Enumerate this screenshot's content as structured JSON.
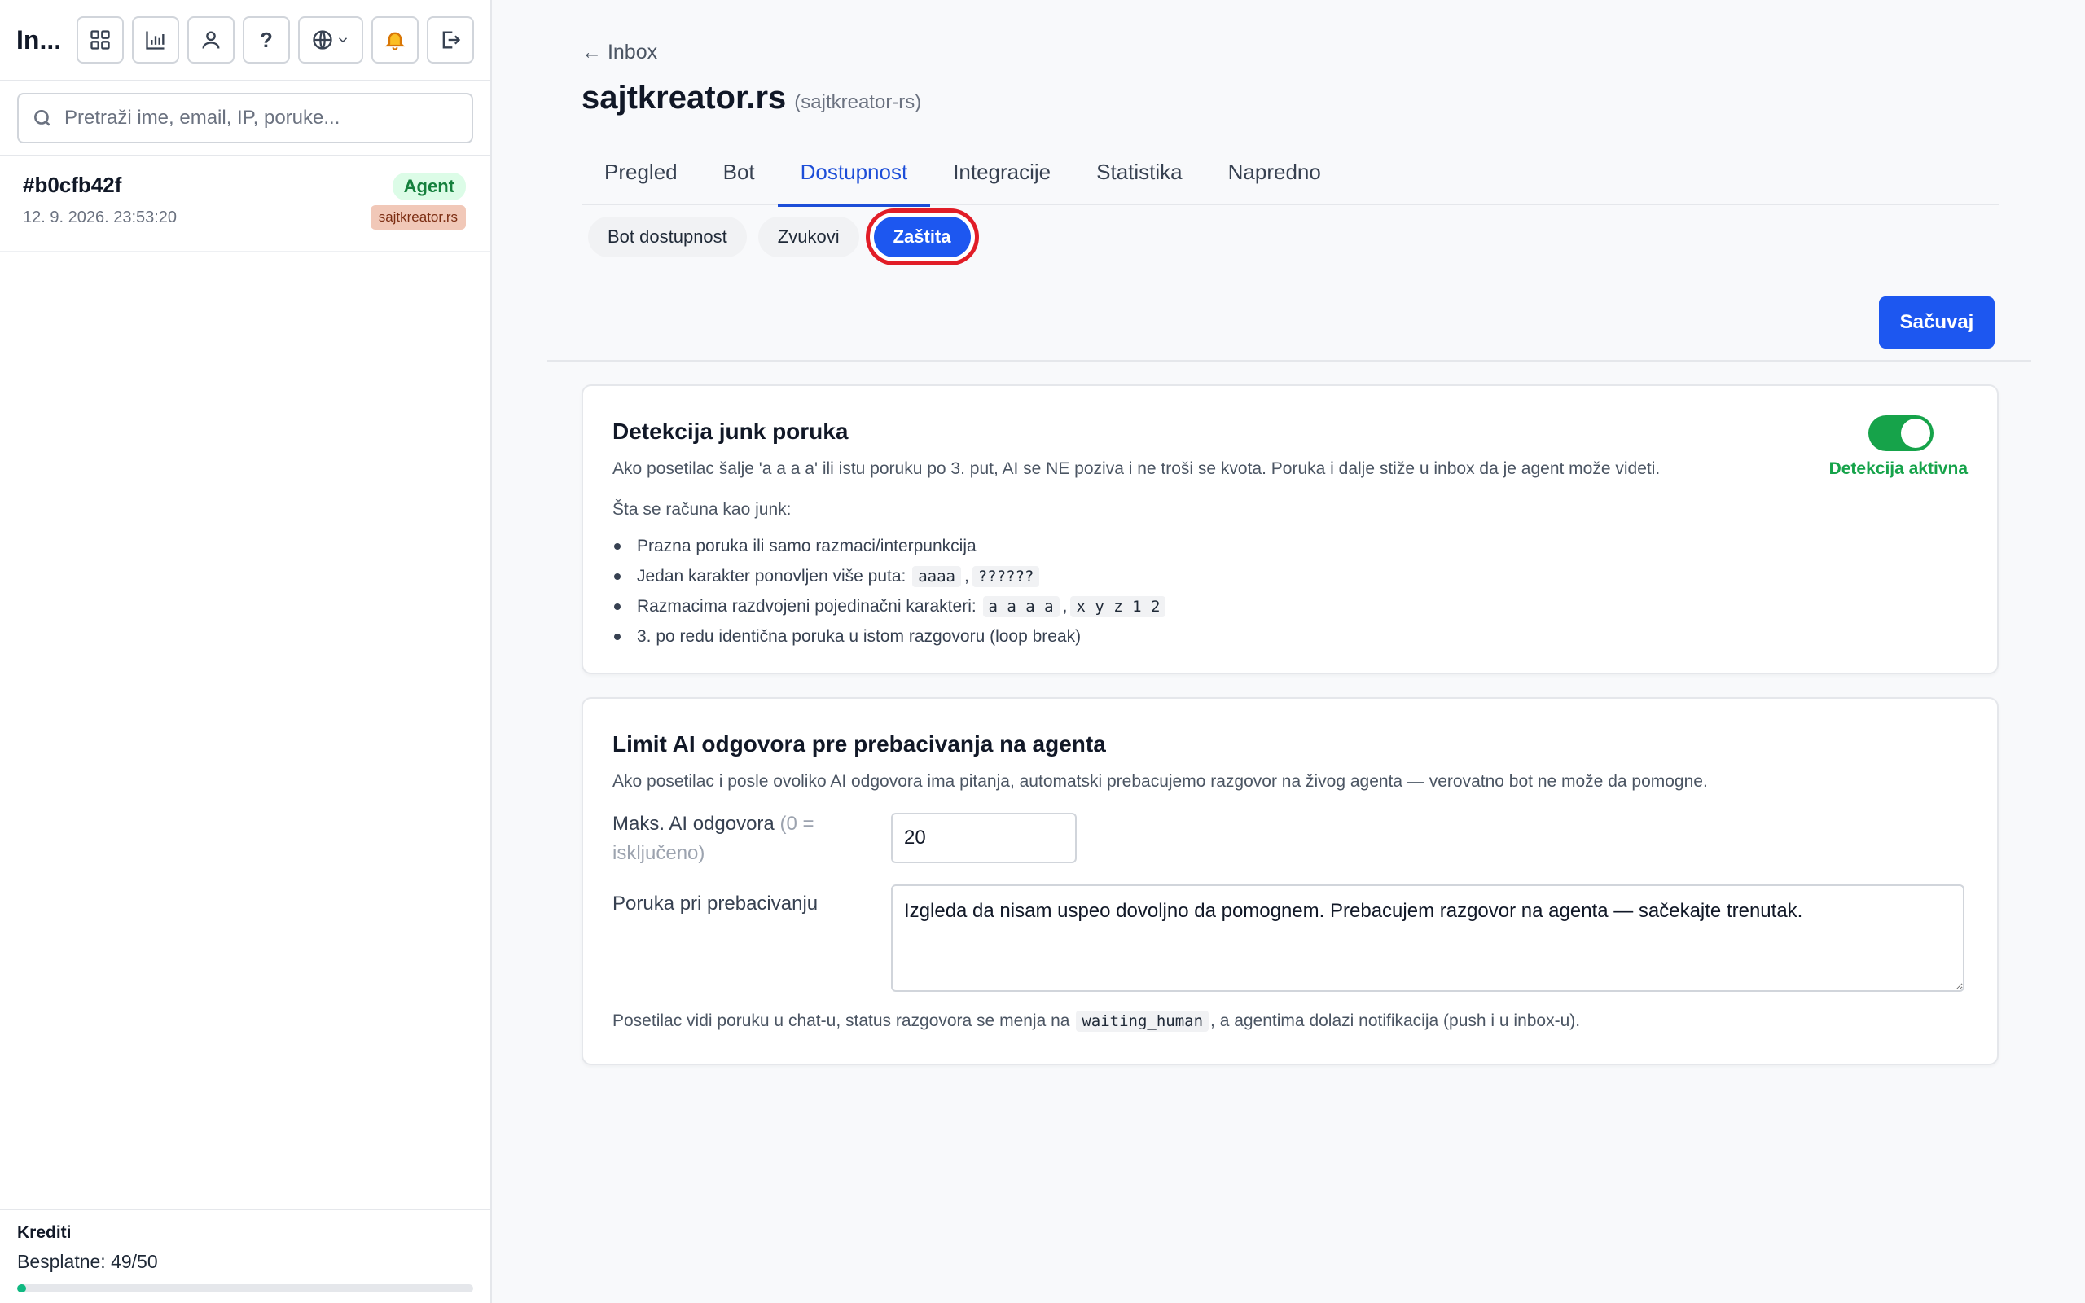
{
  "sidebar": {
    "app_title": "In...",
    "language_icon": "globe-icon",
    "search": {
      "placeholder": "Pretraži ime, email, IP, poruke..."
    },
    "conversations": [
      {
        "id": "#b0cfb42f",
        "date": "12. 9. 2026. 23:53:20",
        "status": "Agent",
        "site": "sajtkreator.rs"
      }
    ],
    "credits": {
      "label": "Krediti",
      "value": "Besplatne: 49/50",
      "used": 49,
      "total": 50
    }
  },
  "header": {
    "back_label": "← Inbox",
    "title": "sajtkreator.rs",
    "slug": "(sajtkreator-rs)"
  },
  "tabs": [
    "Pregled",
    "Bot",
    "Dostupnost",
    "Integracije",
    "Statistika",
    "Napredno"
  ],
  "active_tab": "Dostupnost",
  "subtabs": [
    "Bot dostupnost",
    "Zvukovi",
    "Zaštita"
  ],
  "active_subtab": "Zaštita",
  "save_label": "Sačuvaj",
  "junk": {
    "title": "Detekcija junk poruka",
    "description": "Ako posetilac šalje 'a a a a' ili istu poruku po 3. put, AI se NE poziva i ne troši se kvota. Poruka i dalje stiže u inbox da je agent može videti.",
    "list_heading": "Šta se računa kao junk:",
    "item1": "Prazna poruka ili samo razmaci/interpunkcija",
    "item2": "Jedan karakter ponovljen više puta:",
    "item2_code1": "aaaa",
    "item2_code2": "??????",
    "item3": "Razmacima razdvojeni pojedinačni karakteri:",
    "item3_code1": "a a a a",
    "item3_code2": "x y z 1 2",
    "item4": "3. po redu identična poruka u istom razgovoru (loop break)",
    "toggle_on": true,
    "toggle_label": "Detekcija aktivna"
  },
  "limit": {
    "title": "Limit AI odgovora pre prebacivanja na agenta",
    "description": "Ako posetilac i posle ovoliko AI odgovora ima pitanja, automatski prebacujemo razgovor na živog agenta — verovatno bot ne može da pomogne.",
    "max_label": "Maks. AI odgovora",
    "max_hint": "(0 = isključeno)",
    "max_value": "20",
    "message_label": "Poruka pri prebacivanju",
    "message_value": "Izgleda da nisam uspeo dovoljno da pomognem. Prebacujem razgovor na agenta — sačekajte trenutak.",
    "footnote_before": "Posetilac vidi poruku u chat-u, status razgovora se menja na",
    "footnote_code": "waiting_human",
    "footnote_after": ", a agentima dolazi notifikacija (push i u inbox-u)."
  },
  "colors": {
    "accent": "#1d57f0",
    "success": "#16a34a",
    "highlight": "#e11d27"
  }
}
